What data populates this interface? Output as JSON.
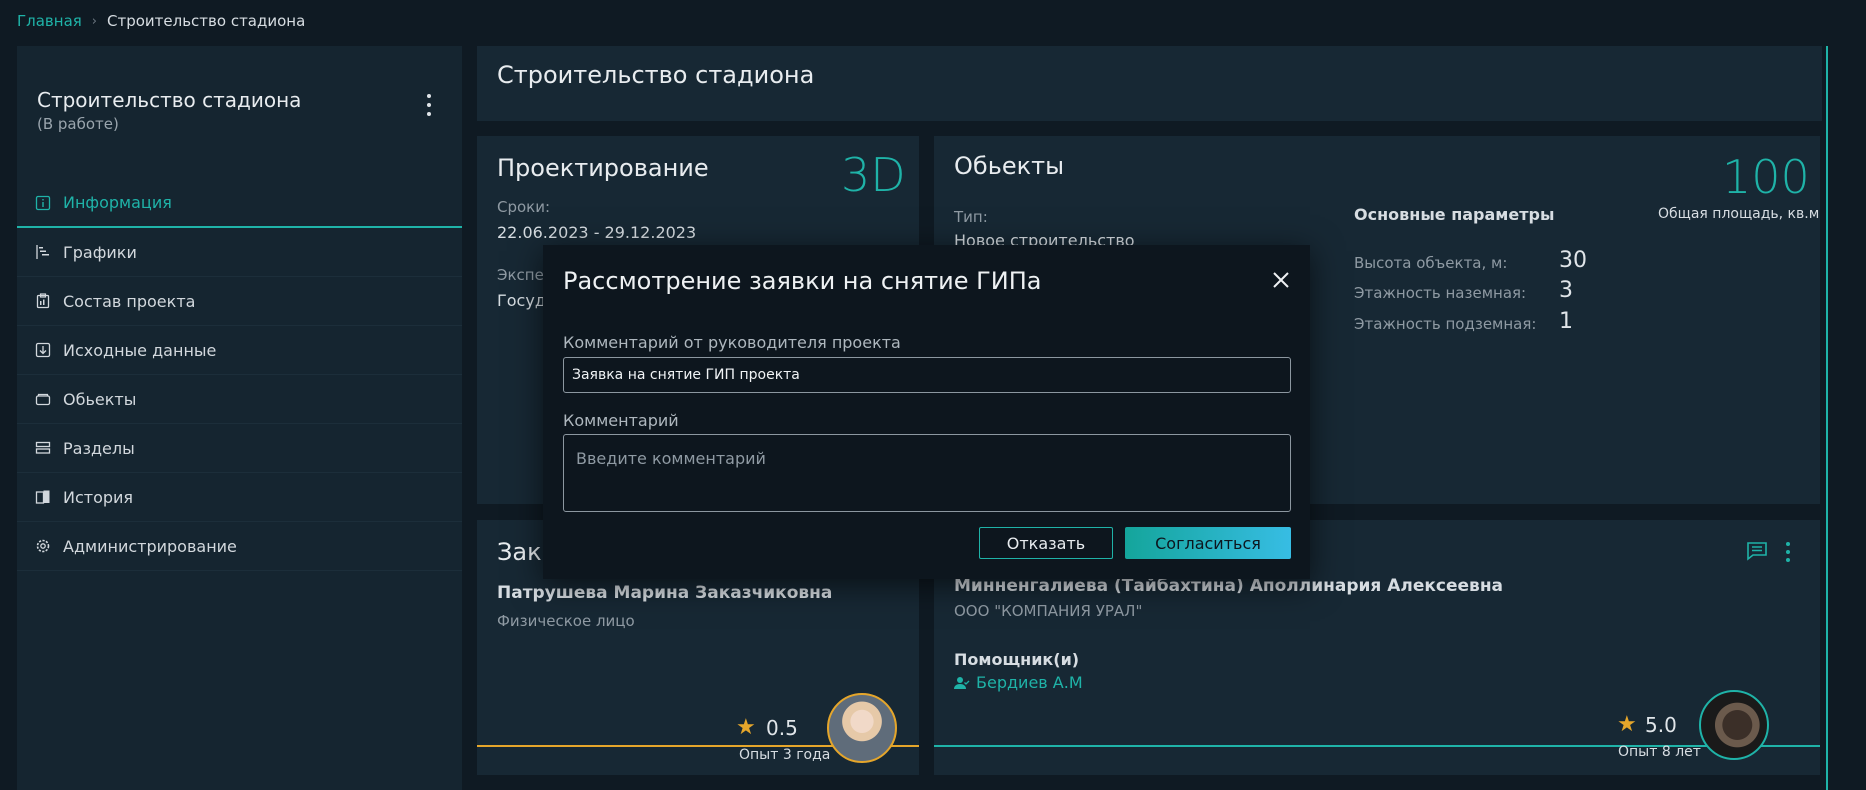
{
  "breadcrumb": {
    "home": "Главная",
    "separator": "›",
    "current": "Строительство стадиона"
  },
  "sidebar": {
    "title": "Строительство стадиона",
    "status": "(В работе)",
    "items": [
      {
        "label": "Информация",
        "icon": "info-icon",
        "active": true
      },
      {
        "label": "Графики",
        "icon": "gantt-icon"
      },
      {
        "label": "Состав проекта",
        "icon": "clipboard-icon"
      },
      {
        "label": "Исходные данные",
        "icon": "download-icon"
      },
      {
        "label": "Обьекты",
        "icon": "folder-icon"
      },
      {
        "label": "Разделы",
        "icon": "sections-icon"
      },
      {
        "label": "История",
        "icon": "history-icon"
      },
      {
        "label": "Администрирование",
        "icon": "gear-icon"
      }
    ]
  },
  "header": {
    "title": "Строительство стадиона"
  },
  "design": {
    "title": "Проектирование",
    "badge": "3D",
    "terms_label": "Сроки:",
    "terms_value": "22.06.2023 - 29.12.2023",
    "expertise_label": "Экспе",
    "expertise_value": "Госуда"
  },
  "objects": {
    "title": "Обьекты",
    "type_label": "Тип:",
    "type_value": "Новое строительство",
    "params_title": "Основные параметры",
    "area_value": "100",
    "area_label": "Общая площадь, кв.м",
    "params": [
      {
        "label": "Высота объекта, м:",
        "value": "30"
      },
      {
        "label": "Этажность наземная:",
        "value": "3"
      },
      {
        "label": "Этажность подземная:",
        "value": "1"
      }
    ]
  },
  "customer": {
    "title": "Зака",
    "name": "Патрушева Марина Заказчиковна",
    "type": "Физическое лицо",
    "rating": "0.5",
    "experience": "Опыт 3 года"
  },
  "gip": {
    "name": "Минненгалиева (Тайбахтина) Аполлинария Алексеевна",
    "company": "ООО \"КОМПАНИЯ УРАЛ\"",
    "assistants_label": "Помощник(и)",
    "assistant": "Бердиев А.М",
    "rating": "5.0",
    "experience": "Опыт 8 лет"
  },
  "modal": {
    "title": "Рассмотрение заявки на снятие ГИПа",
    "manager_comment_label": "Комментарий от руководителя проекта",
    "manager_comment_value": "Заявка на снятие ГИП проекта",
    "comment_label": "Комментарий",
    "comment_placeholder": "Введите комментарий",
    "cancel_label": "Отказать",
    "accept_label": "Согласиться"
  },
  "colors": {
    "accent": "#1fb3a8",
    "gold": "#e5a62b",
    "background": "#0f1a23",
    "card": "#172834"
  }
}
